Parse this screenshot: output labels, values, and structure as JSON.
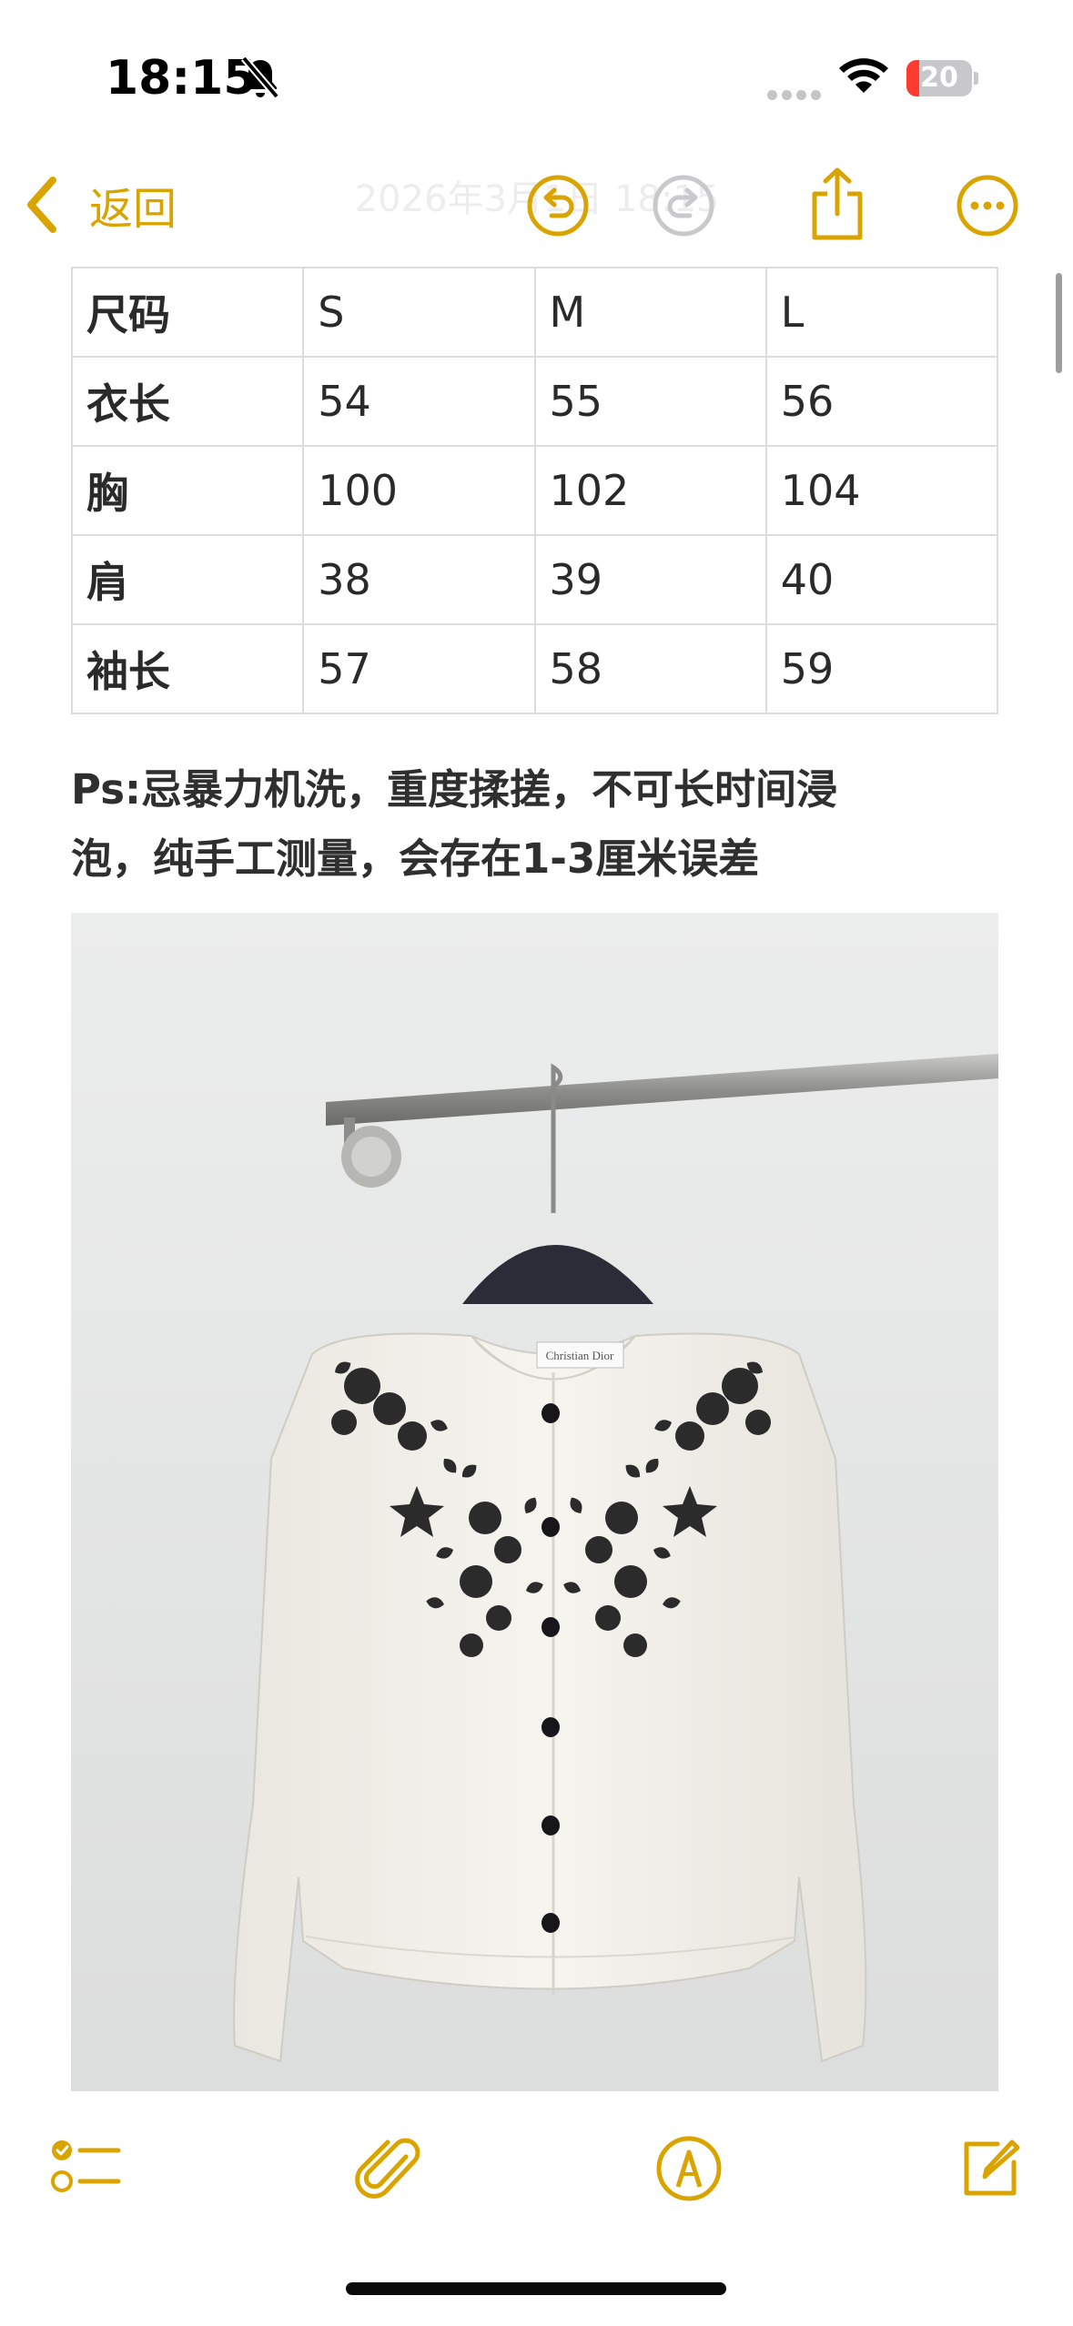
{
  "status_bar": {
    "time": "18:15",
    "battery_percent": "20",
    "battery_level": 0.2,
    "battery_color": "#ff3b30",
    "icons": [
      "bell-slash-icon",
      "cellular-icon",
      "wifi-icon",
      "battery-icon"
    ]
  },
  "nav": {
    "back_label": "返回",
    "title": "2026年3月1日 18:15",
    "accent_color": "#d9a400",
    "icons": [
      "chevron-left-icon",
      "undo-icon",
      "redo-icon",
      "share-icon",
      "more-icon"
    ]
  },
  "size_table": {
    "rows": [
      [
        "尺码",
        "S",
        "M",
        "L"
      ],
      [
        "衣长",
        "54",
        "55",
        "56"
      ],
      [
        "胸",
        "100",
        "102",
        "104"
      ],
      [
        "肩",
        "38",
        "39",
        "40"
      ],
      [
        "袖长",
        "57",
        "58",
        "59"
      ]
    ]
  },
  "note": {
    "line1": "Ps:忌暴力机洗，重度揉搓，不可长时间浸",
    "line2": "泡，纯手工测量，会存在1-3厘米误差"
  },
  "photo": {
    "label_text": "Christian Dior"
  },
  "toolbar": {
    "icons": [
      "checklist-icon",
      "paperclip-icon",
      "markup-pen-icon",
      "compose-icon"
    ]
  }
}
